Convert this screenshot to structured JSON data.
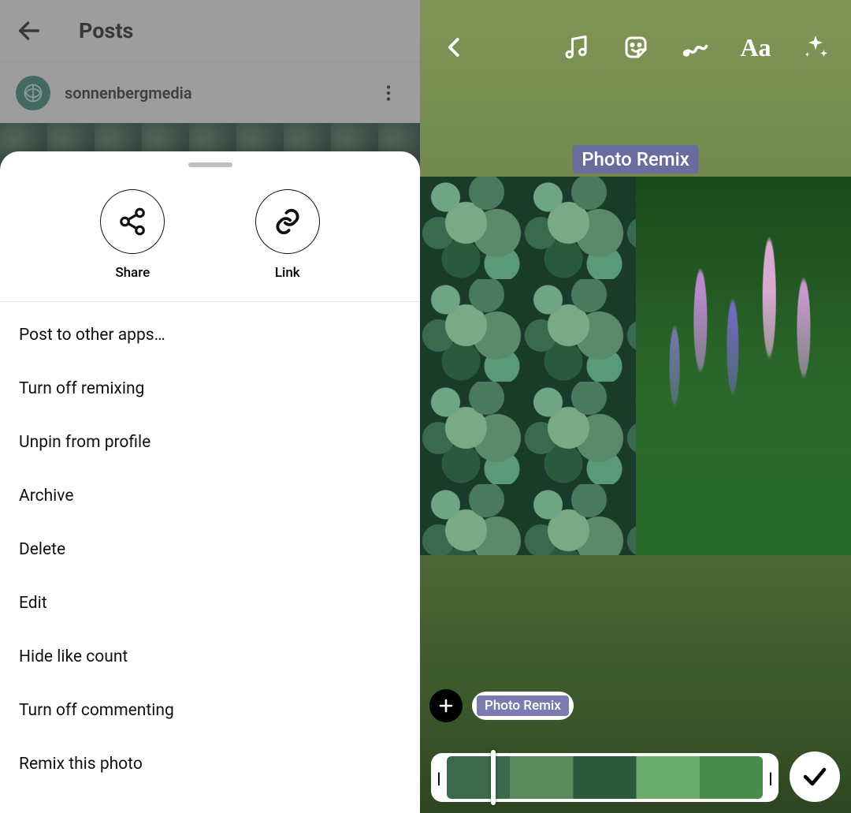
{
  "left": {
    "header": {
      "title": "Posts"
    },
    "post": {
      "username": "sonnenbergmedia"
    },
    "sheet": {
      "share_label": "Share",
      "link_label": "Link",
      "items": [
        "Post to other apps…",
        "Turn off remixing",
        "Unpin from profile",
        "Archive",
        "Delete",
        "Edit",
        "Hide like count",
        "Turn off commenting",
        "Remix this photo"
      ]
    }
  },
  "right": {
    "badge": "Photo Remix",
    "chip": "Photo Remix",
    "toolbar_icons": [
      "music-icon",
      "sticker-icon",
      "scribble-icon",
      "text-icon",
      "sparkle-icon"
    ],
    "text_tool_label": "Aa"
  }
}
